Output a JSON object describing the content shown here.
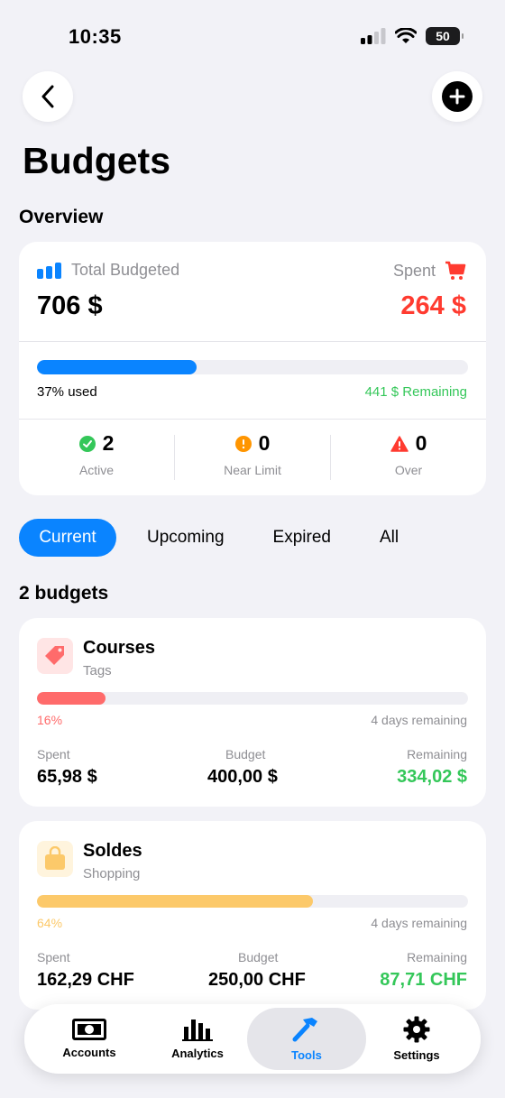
{
  "status_bar": {
    "time": "10:35",
    "battery": "50"
  },
  "page": {
    "title": "Budgets"
  },
  "overview": {
    "section_title": "Overview",
    "total_label": "Total Budgeted",
    "total_value": "706 $",
    "spent_label": "Spent",
    "spent_value": "264 $",
    "progress_fraction": 0.37,
    "used_text": "37% used",
    "remaining_text": "441 $ Remaining",
    "stats": [
      {
        "count": "2",
        "label": "Active",
        "color": "#34c759"
      },
      {
        "count": "0",
        "label": "Near Limit",
        "color": "#ff9500"
      },
      {
        "count": "0",
        "label": "Over",
        "color": "#ff3b30"
      }
    ]
  },
  "tabs": [
    {
      "label": "Current",
      "active": true
    },
    {
      "label": "Upcoming",
      "active": false
    },
    {
      "label": "Expired",
      "active": false
    },
    {
      "label": "All",
      "active": false
    }
  ],
  "budgets_count": "2 budgets",
  "budgets": [
    {
      "name": "Courses",
      "category": "Tags",
      "icon": "tag-icon",
      "color": "#ff6b6b",
      "progress_fraction": 0.16,
      "percent": "16%",
      "days_remaining": "4 days remaining",
      "spent_label": "Spent",
      "spent": "65,98 $",
      "budget_label": "Budget",
      "budget": "400,00 $",
      "remaining_label": "Remaining",
      "remaining": "334,02 $"
    },
    {
      "name": "Soldes",
      "category": "Shopping",
      "icon": "shopping-bag-icon",
      "color": "#fcc96a",
      "progress_fraction": 0.64,
      "percent": "64%",
      "days_remaining": "4 days remaining",
      "spent_label": "Spent",
      "spent": "162,29 CHF",
      "budget_label": "Budget",
      "budget": "250,00 CHF",
      "remaining_label": "Remaining",
      "remaining": "87,71 CHF"
    }
  ],
  "tabbar": [
    {
      "label": "Accounts",
      "icon": "banknote-icon",
      "active": false
    },
    {
      "label": "Analytics",
      "icon": "bar-chart-icon",
      "active": false
    },
    {
      "label": "Tools",
      "icon": "hammer-icon",
      "active": true
    },
    {
      "label": "Settings",
      "icon": "gear-icon",
      "active": false
    }
  ],
  "colors": {
    "accent": "#0a84ff",
    "spent": "#ff3b30",
    "remaining": "#34c759"
  }
}
